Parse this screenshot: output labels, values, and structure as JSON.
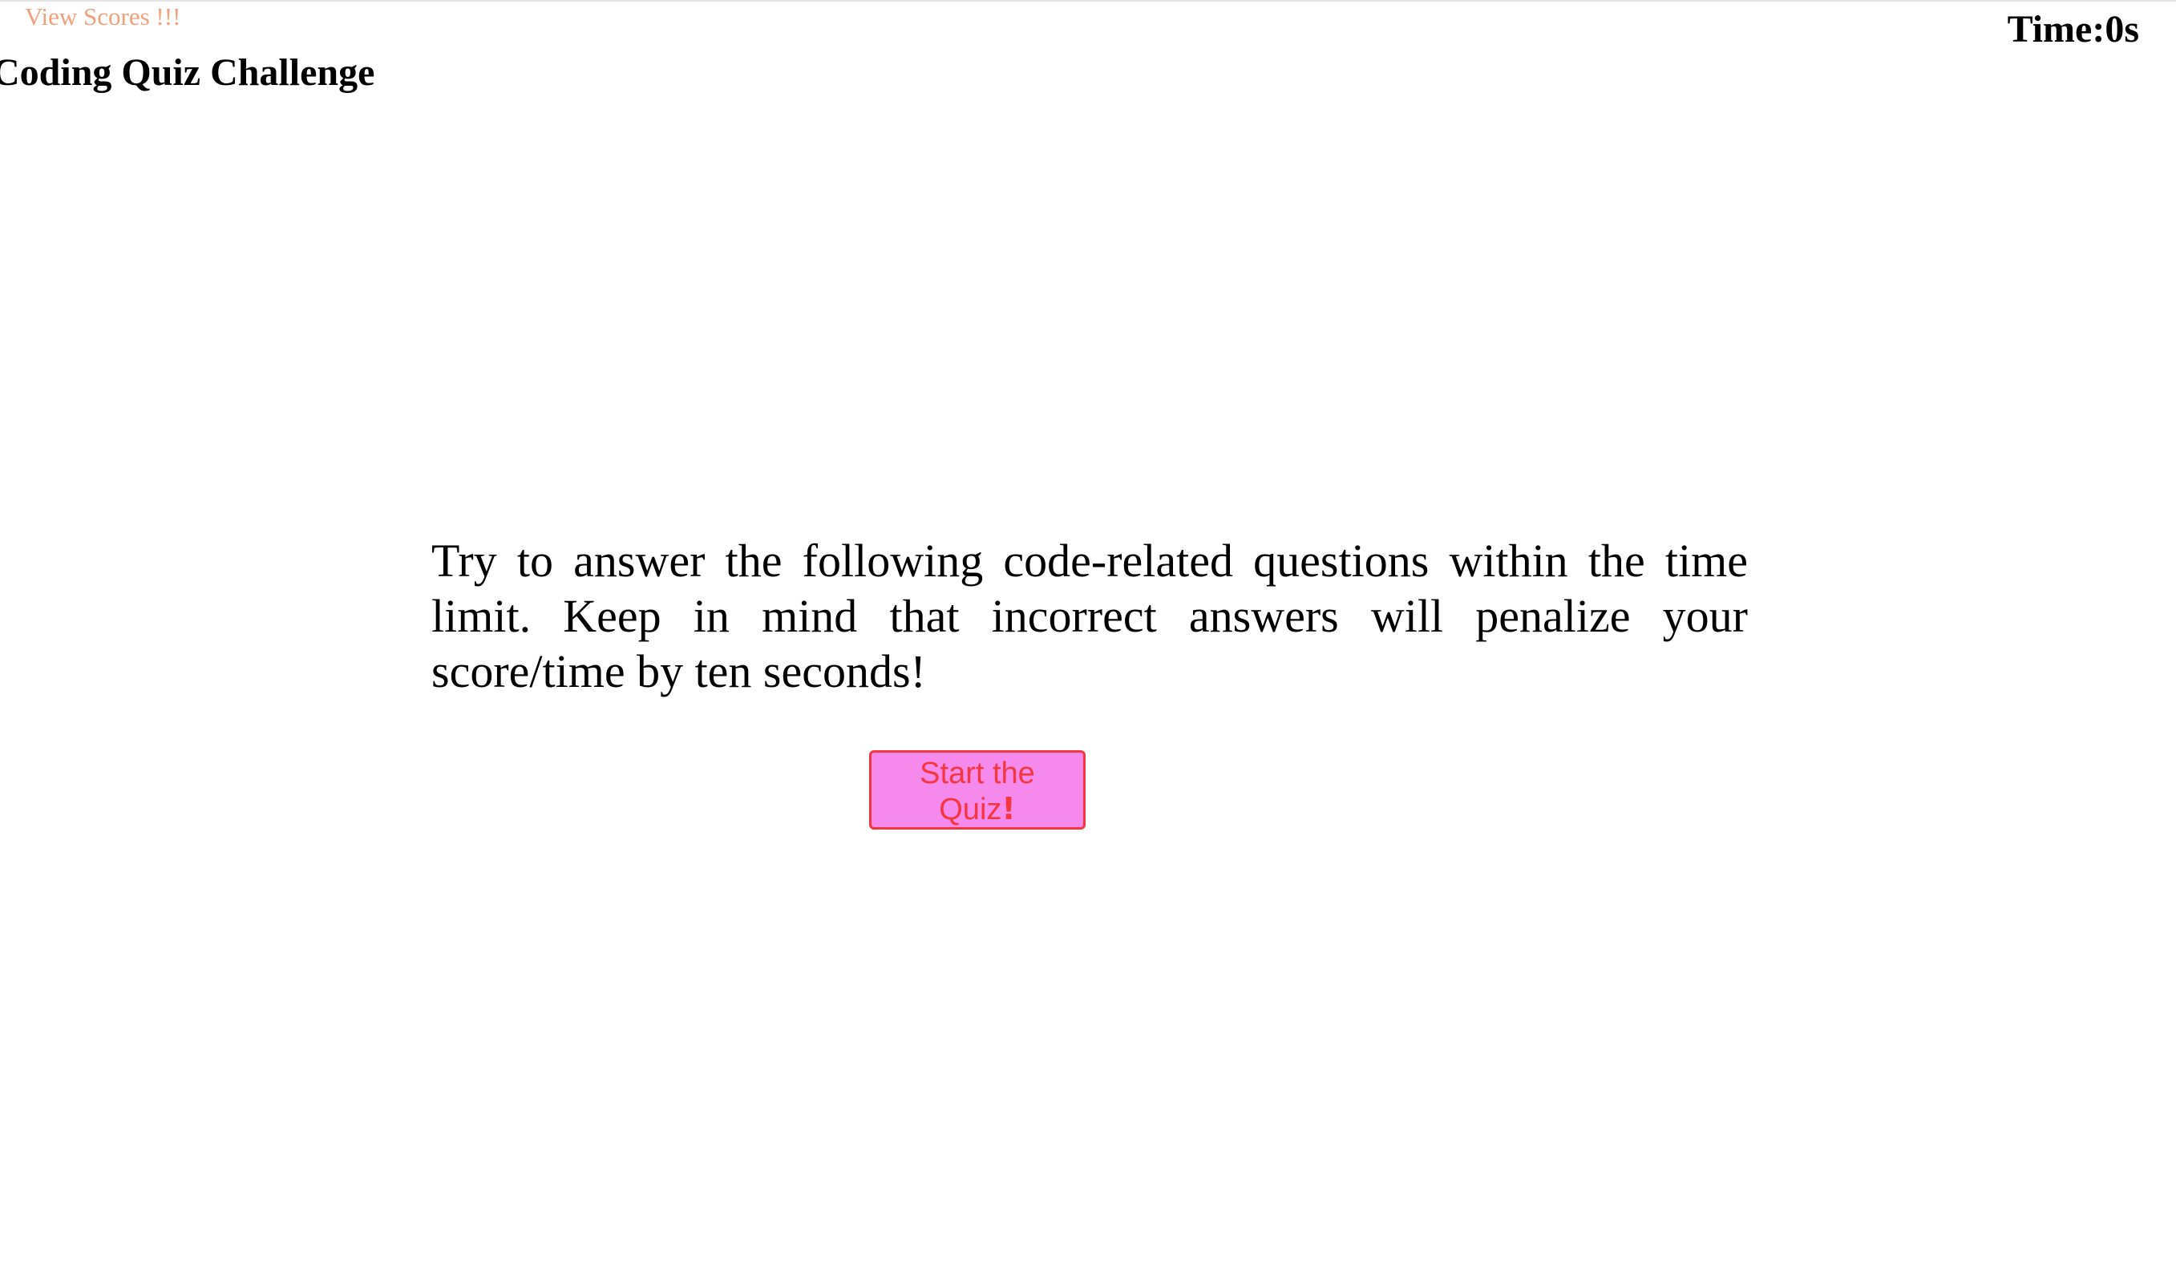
{
  "header": {
    "view_scores_label": "View Scores !!!",
    "title": "Coding Quiz Challenge",
    "timer_text": "Time:0s"
  },
  "main": {
    "intro_text": "Try to answer the following code-related questions within the time limit. Keep in mind that incorrect answers will penalize your score/time by ten seconds!",
    "start_button": {
      "label_text": "Start the Quiz",
      "label_emphasis": "!"
    }
  },
  "colors": {
    "link": "#f2a07b",
    "button_background": "#f58aec",
    "button_border": "#f5363f",
    "button_text": "#f5363f"
  }
}
